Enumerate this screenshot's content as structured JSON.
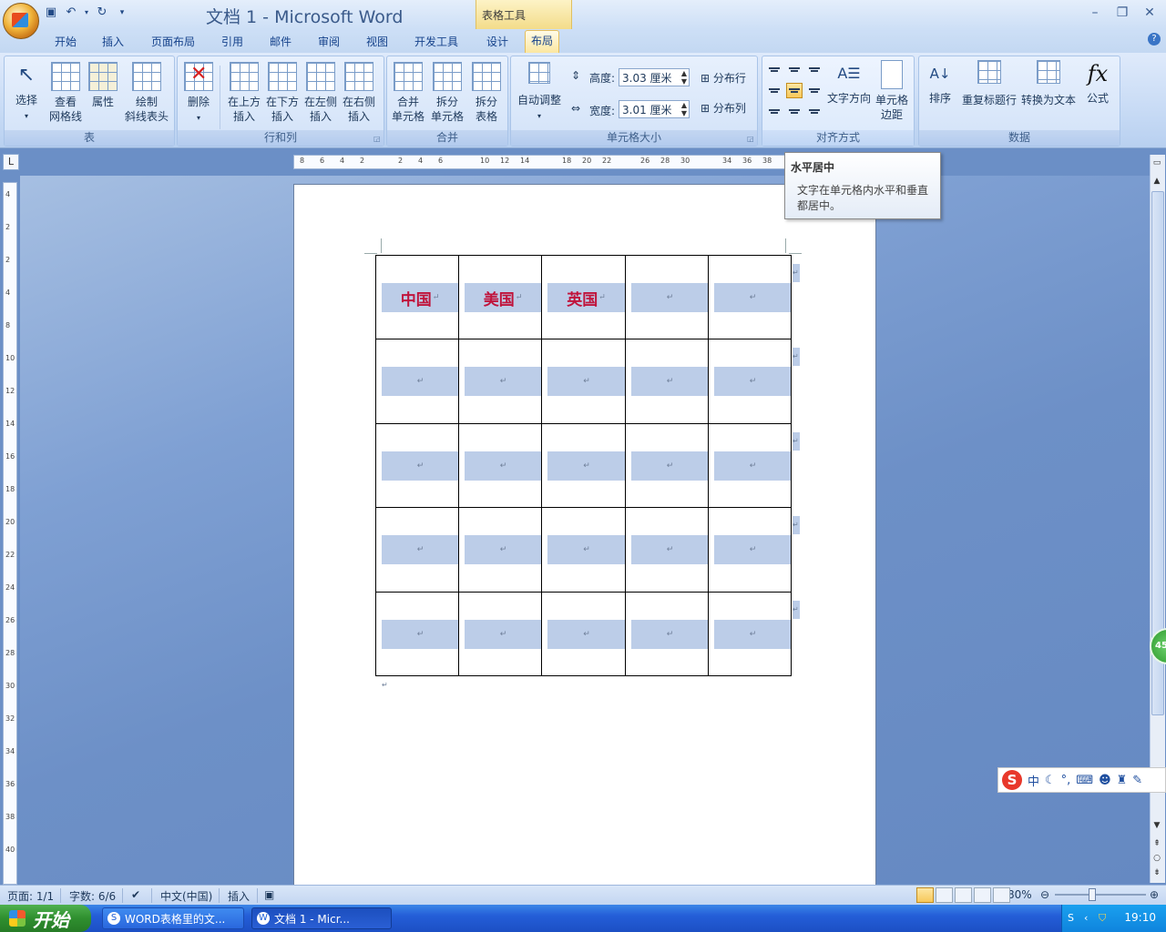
{
  "window": {
    "title": "文档 1 - Microsoft Word",
    "context_tab_group": "表格工具"
  },
  "tabs": [
    "开始",
    "插入",
    "页面布局",
    "引用",
    "邮件",
    "审阅",
    "视图",
    "开发工具",
    "设计",
    "布局"
  ],
  "active_tab": "布局",
  "ribbon": {
    "groups": {
      "table": "表",
      "rows_cols": "行和列",
      "merge": "合并",
      "cell_size": "单元格大小",
      "alignment": "对齐方式",
      "data": "数据"
    },
    "buttons": {
      "select": "选择",
      "gridlines_1": "查看",
      "gridlines_2": "网格线",
      "properties": "属性",
      "draw_diag_1": "绘制",
      "draw_diag_2": "斜线表头",
      "delete": "删除",
      "insert_above_1": "在上方",
      "insert_above_2": "插入",
      "insert_below_1": "在下方",
      "insert_below_2": "插入",
      "insert_left_1": "在左侧",
      "insert_left_2": "插入",
      "insert_right_1": "在右侧",
      "insert_right_2": "插入",
      "merge_cells_1": "合并",
      "merge_cells_2": "单元格",
      "split_cells_1": "拆分",
      "split_cells_2": "单元格",
      "split_table_1": "拆分",
      "split_table_2": "表格",
      "autofit": "自动调整",
      "height_label": "高度:",
      "width_label": "宽度:",
      "distribute_rows": "分布行",
      "distribute_cols": "分布列",
      "text_direction": "文字方向",
      "cell_margins_1": "单元格",
      "cell_margins_2": "边距",
      "sort": "排序",
      "repeat_header": "重复标题行",
      "convert_text": "转换为文本",
      "formula": "公式"
    },
    "height_value": "3.03 厘米",
    "width_value": "3.01 厘米"
  },
  "tooltip": {
    "title": "水平居中",
    "body": "文字在单元格内水平和垂直都居中。"
  },
  "ruler": {
    "h_marks": [
      "8",
      "6",
      "4",
      "2",
      "2",
      "4",
      "6",
      "10",
      "12",
      "14",
      "18",
      "20",
      "22",
      "26",
      "28",
      "30",
      "34",
      "36",
      "38"
    ],
    "v_marks": [
      "4",
      "2",
      "2",
      "4",
      "8",
      "10",
      "12",
      "14",
      "16",
      "18",
      "20",
      "22",
      "24",
      "26",
      "28",
      "30",
      "32",
      "34",
      "36",
      "38",
      "40"
    ]
  },
  "table": {
    "header": [
      "中国",
      "美国",
      "英国",
      "",
      ""
    ],
    "return_mark": "↵",
    "rows": 5,
    "cols": 5
  },
  "ime": {
    "mode": "中"
  },
  "statusbar": {
    "page": "页面: 1/1",
    "words": "字数: 6/6",
    "language": "中文(中国)",
    "insert_mode": "插入",
    "zoom": "80%"
  },
  "taskbar": {
    "start": "开始",
    "items": [
      "WORD表格里的文...",
      "文档 1 - Micr..."
    ],
    "clock": "19:10"
  },
  "side_badge": "45"
}
